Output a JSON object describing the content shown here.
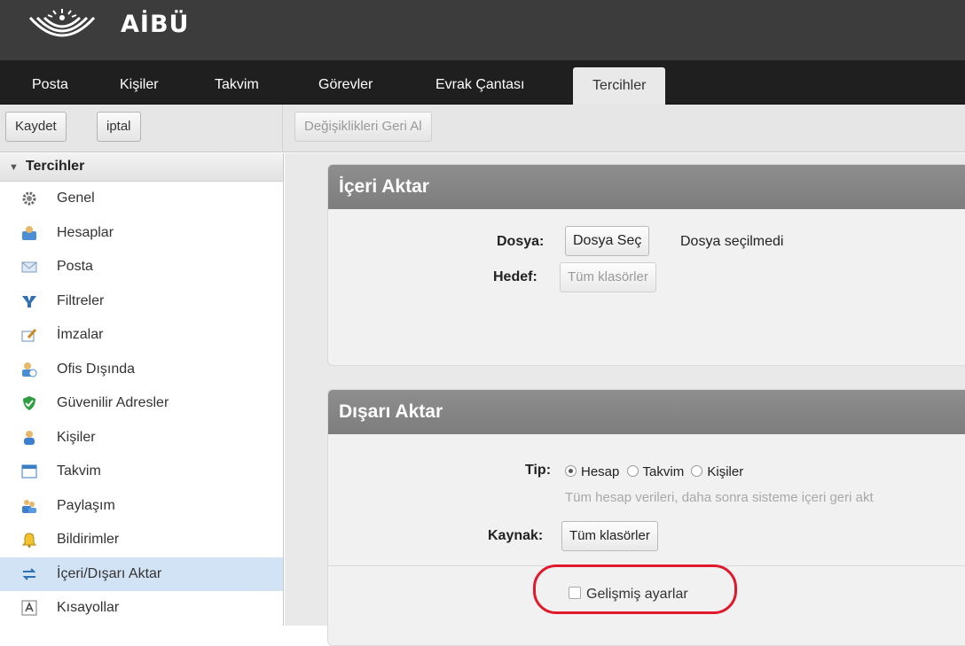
{
  "brand": {
    "name": "AİBÜ"
  },
  "nav": {
    "tabs": [
      {
        "label": "Posta"
      },
      {
        "label": "Kişiler"
      },
      {
        "label": "Takvim"
      },
      {
        "label": "Görevler"
      },
      {
        "label": "Evrak Çantası"
      },
      {
        "label": "Tercihler",
        "active": true
      }
    ]
  },
  "toolbar": {
    "save_label": "Kaydet",
    "cancel_label": "iptal",
    "revert_label": "Değişiklikleri Geri Al"
  },
  "sidebar": {
    "header": "Tercihler",
    "items": [
      {
        "label": "Genel",
        "icon": "gear-icon"
      },
      {
        "label": "Hesaplar",
        "icon": "accounts-icon"
      },
      {
        "label": "Posta",
        "icon": "envelope-icon"
      },
      {
        "label": "Filtreler",
        "icon": "filter-icon"
      },
      {
        "label": "İmzalar",
        "icon": "signature-icon"
      },
      {
        "label": "Ofis Dışında",
        "icon": "out-of-office-icon"
      },
      {
        "label": "Güvenilir Adresler",
        "icon": "shield-check-icon"
      },
      {
        "label": "Kişiler",
        "icon": "person-icon"
      },
      {
        "label": "Takvim",
        "icon": "calendar-icon"
      },
      {
        "label": "Paylaşım",
        "icon": "sharing-icon"
      },
      {
        "label": "Bildirimler",
        "icon": "bell-icon"
      },
      {
        "label": "İçeri/Dışarı Aktar",
        "icon": "import-export-icon",
        "active": true
      },
      {
        "label": "Kısayollar",
        "icon": "shortcut-icon"
      }
    ]
  },
  "import": {
    "title": "İçeri Aktar",
    "file_label": "Dosya:",
    "file_button": "Dosya Seç",
    "file_status": "Dosya seçilmedi",
    "target_label": "Hedef:",
    "target_button": "Tüm klasörler"
  },
  "export": {
    "title": "Dışarı Aktar",
    "type_label": "Tip:",
    "type_options": [
      "Hesap",
      "Takvim",
      "Kişiler"
    ],
    "type_selected": "Hesap",
    "hint": "Tüm hesap verileri, daha sonra sisteme içeri geri akt",
    "source_label": "Kaynak:",
    "source_button": "Tüm klasörler",
    "advanced_label": "Gelişmiş ayarlar"
  },
  "colors": {
    "topbar": "#3c3c3c",
    "navbar": "#1f1f1f",
    "panel_title": "#858585",
    "selected_item": "#d3e3f6",
    "highlight_ring": "#e0192d"
  }
}
